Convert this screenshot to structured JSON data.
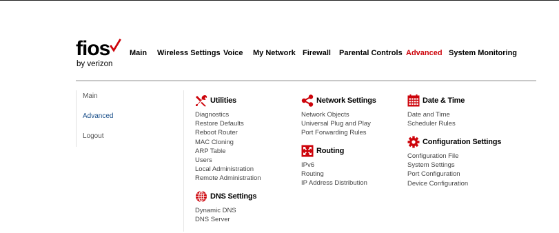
{
  "logo": {
    "brand": "fios",
    "sub": "by verizon"
  },
  "nav": [
    {
      "label": "Main"
    },
    {
      "label": "Wireless Settings"
    },
    {
      "label": "Voice"
    },
    {
      "label": "My Network"
    },
    {
      "label": "Firewall"
    },
    {
      "label": "Parental Controls"
    },
    {
      "label": "Advanced"
    },
    {
      "label": "System Monitoring"
    }
  ],
  "sidebar": [
    {
      "label": "Main"
    },
    {
      "label": "Advanced"
    },
    {
      "label": "Logout"
    }
  ],
  "sections": {
    "utilities": {
      "title": "Utilities",
      "icon": "tools-icon",
      "items": [
        "Diagnostics",
        "Restore Defaults",
        "Reboot Router",
        "MAC Cloning",
        "ARP Table",
        "Users",
        "Local Administration",
        "Remote Administration"
      ]
    },
    "dns": {
      "title": "DNS Settings",
      "icon": "globe-icon",
      "items": [
        "Dynamic DNS",
        "DNS Server"
      ]
    },
    "network": {
      "title": "Network Settings",
      "icon": "share-icon",
      "items": [
        "Network Objects",
        "Universal Plug and Play",
        "Port Forwarding Rules"
      ]
    },
    "routing": {
      "title": "Routing",
      "icon": "routing-icon",
      "items": [
        "IPv6",
        "Routing",
        "IP Address Distribution"
      ]
    },
    "datetime": {
      "title": "Date & Time",
      "icon": "calendar-icon",
      "items": [
        "Date and Time",
        "Scheduler Rules"
      ]
    },
    "config": {
      "title": "Configuration Settings",
      "icon": "gear-icon",
      "items": [
        "Configuration File",
        "System Settings",
        "Port Configuration",
        "Device Configuration"
      ]
    }
  },
  "colors": {
    "accent": "#cd040b",
    "active_side": "#1a4f8a",
    "link": "#444444"
  }
}
